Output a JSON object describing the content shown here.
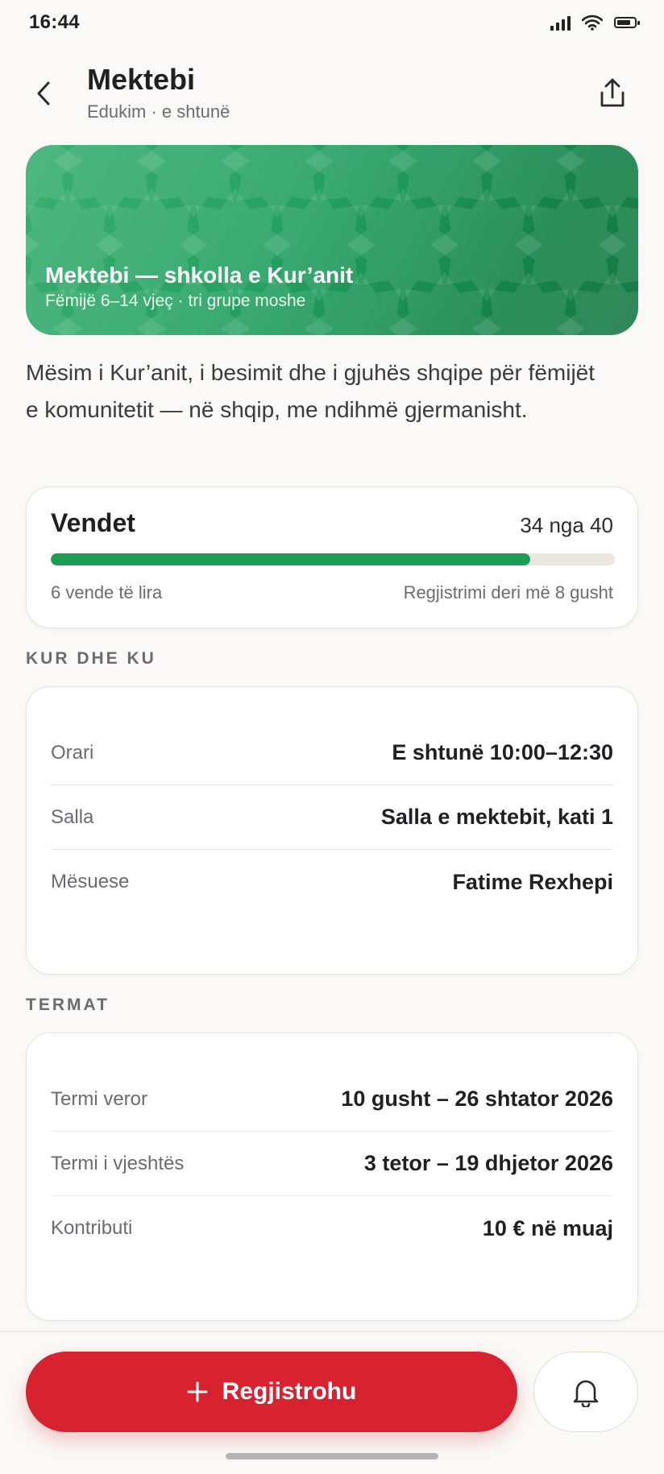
{
  "status_bar": {
    "time": "16:44"
  },
  "header": {
    "title": "Mektebi",
    "subtitle": "Edukim · e shtunë"
  },
  "hero": {
    "title": "Mektebi — shkolla e Kur’anit",
    "subtitle": "Fëmijë 6–14 vjeç · tri grupe moshe",
    "colors": [
      "#39b071",
      "#148248"
    ]
  },
  "description": "Mësim i Kur’anit, i besimit dhe i gjuhës shqipe për fëmijët e komunitetit — në shqip, me ndihmë gjermanisht.",
  "seats": {
    "title": "Vendet",
    "count_text": "34 nga 40",
    "taken": 34,
    "total": 40,
    "free_text": "6 vende të lira",
    "deadline_text": "Regjistrimi deri më 8 gusht",
    "accent": "#1e9e55"
  },
  "when_where": {
    "label": "KUR DHE KU",
    "rows": [
      {
        "key": "Orari",
        "value": "E shtunë 10:00–12:30"
      },
      {
        "key": "Salla",
        "value": "Salla e mektebit, kati 1"
      },
      {
        "key": "Mësuese",
        "value": "Fatime Rexhepi"
      }
    ]
  },
  "terms": {
    "label": "TERMAT",
    "rows": [
      {
        "key": "Termi veror",
        "value": "10 gusht – 26 shtator 2026"
      },
      {
        "key": "Termi i vjeshtës",
        "value": "3 tetor – 19 dhjetor 2026"
      },
      {
        "key": "Kontributi",
        "value": "10 € në muaj"
      }
    ]
  },
  "actions": {
    "register_label": "Regjistrohu",
    "register_icon": "plus-icon",
    "notify_icon": "bell-icon",
    "primary_color": "#d92230"
  }
}
